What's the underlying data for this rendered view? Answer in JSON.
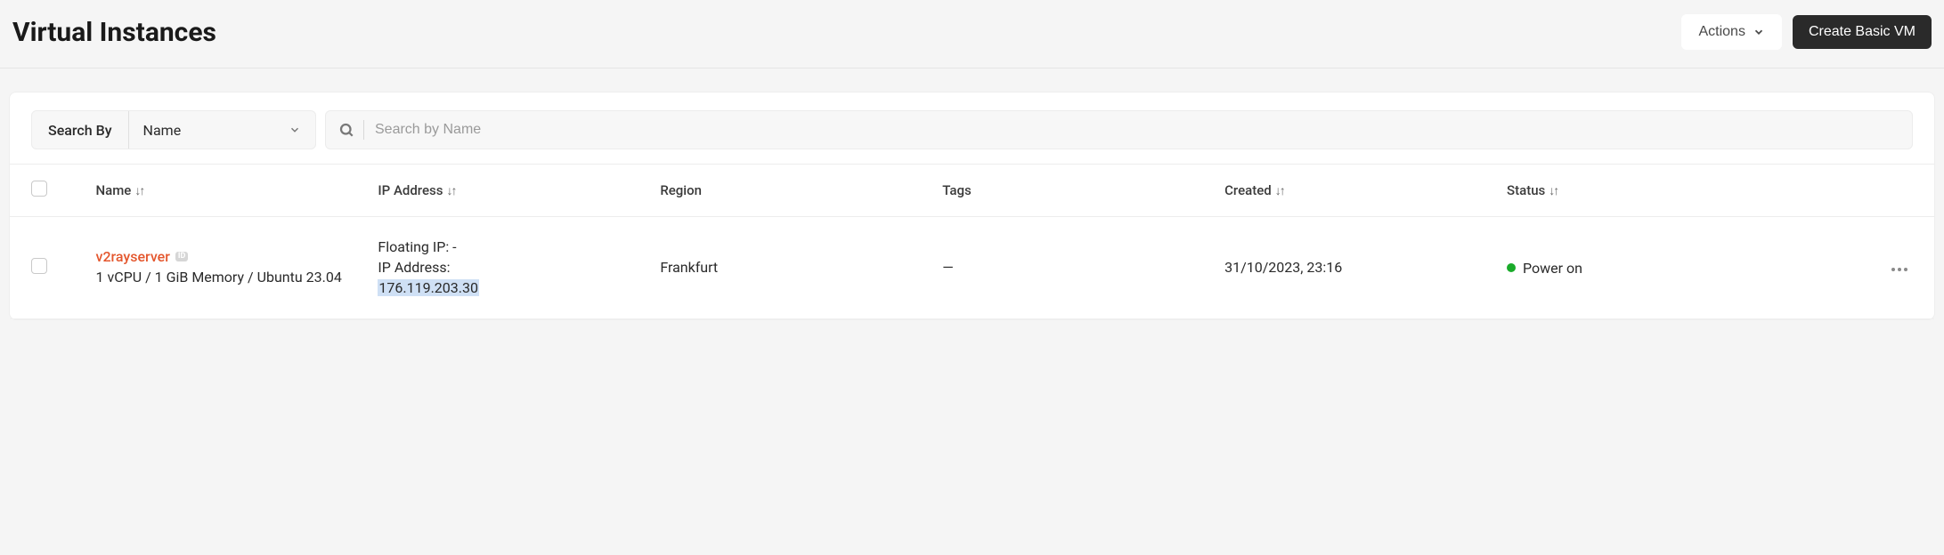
{
  "header": {
    "title": "Virtual Instances",
    "actions_label": "Actions",
    "create_label": "Create Basic VM"
  },
  "filter": {
    "search_by_label": "Search By",
    "search_field": "Name",
    "placeholder": "Search by Name"
  },
  "columns": {
    "name": "Name",
    "ip": "IP Address",
    "region": "Region",
    "tags": "Tags",
    "created": "Created",
    "status": "Status"
  },
  "row": {
    "name": "v2rayserver",
    "id_badge": "ID",
    "spec": "1 vCPU / 1 GiB Memory / Ubuntu 23.04",
    "floating_ip_label": "Floating IP: -",
    "ip_label": "IP Address:",
    "ip_value": "176.119.203.30",
    "region": "Frankfurt",
    "tags": "—",
    "created": "31/10/2023, 23:16",
    "status": "Power on",
    "status_color": "#1aab2a"
  }
}
